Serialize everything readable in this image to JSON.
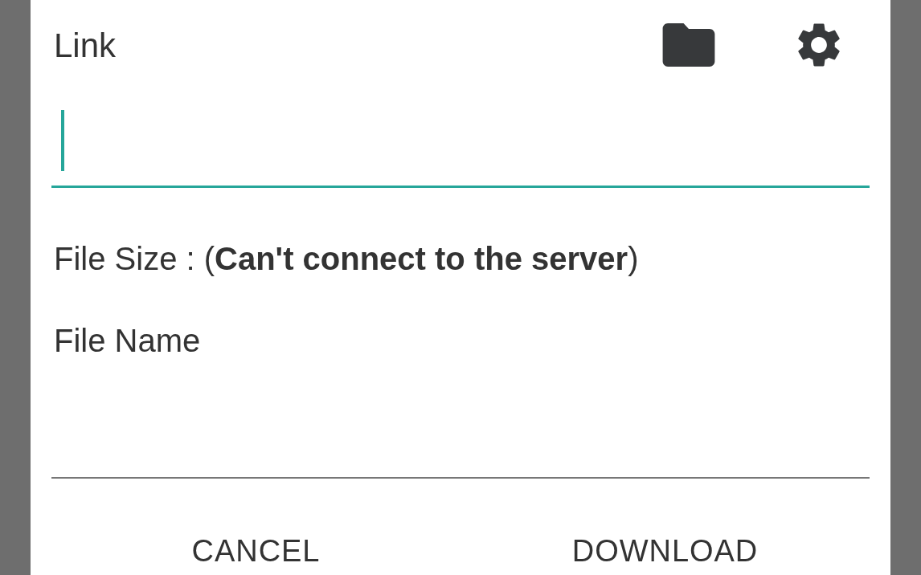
{
  "dialog": {
    "title": "Link",
    "link_field": {
      "focused": true
    },
    "file_size": "File Size : (**Can't connect to the server**)",
    "file_name_field": {
      "label": "File Name",
      "focused": false
    },
    "buttons": [
      "CANCEL",
      "DOWNLOAD"
    ]
  }
}
